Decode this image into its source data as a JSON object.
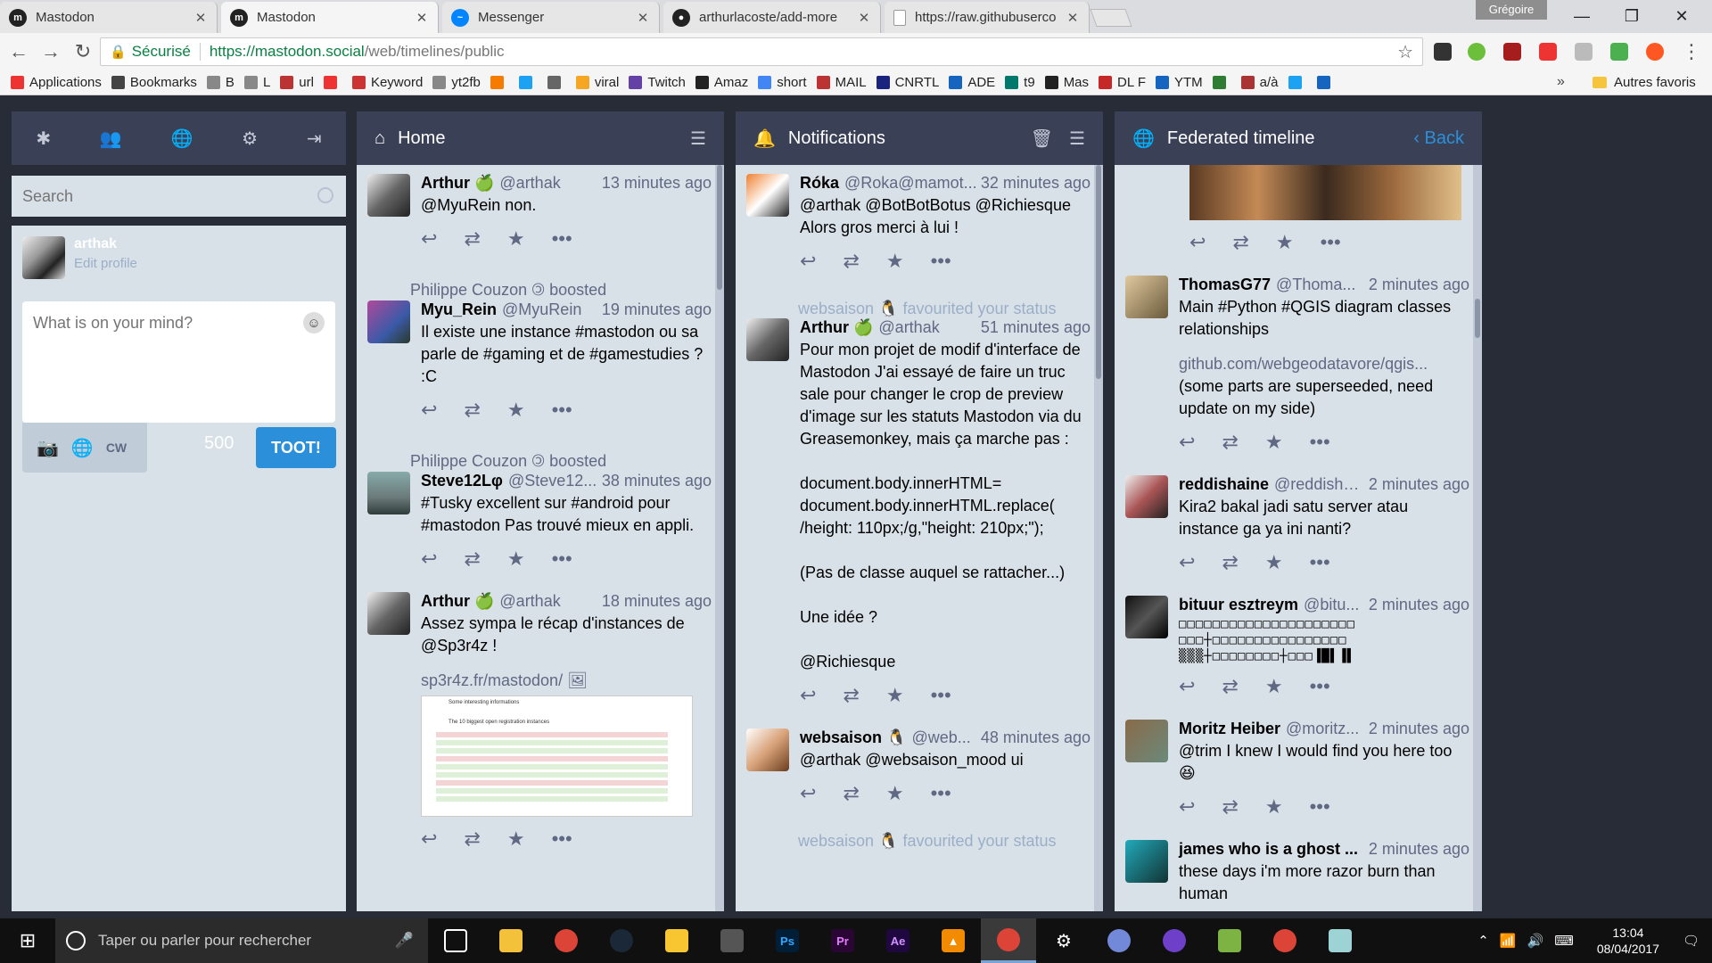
{
  "tabs": [
    {
      "title": "Mastodon",
      "icon": "mastodon-icon",
      "color": "#333"
    },
    {
      "title": "Mastodon",
      "icon": "mastodon-icon",
      "color": "#333"
    },
    {
      "title": "Messenger",
      "icon": "messenger-icon",
      "color": "#0084ff"
    },
    {
      "title": "arthurlacoste/add-more",
      "icon": "github-icon",
      "color": "#222"
    },
    {
      "title": "https://raw.githubuserco",
      "icon": "page-icon",
      "color": "#999"
    }
  ],
  "profile_name": "Grégoire",
  "address": {
    "secure_label": "Sécurisé",
    "host": "https://mastodon.social",
    "path": "/web/timelines/public"
  },
  "bookmarks": [
    "Applications",
    "Bookmarks",
    "B",
    "L",
    "url",
    "",
    "Keyword",
    "yt2fb",
    "",
    "",
    "",
    "viral",
    "Twitch",
    "Amaz",
    "short",
    "MAIL",
    "CNRTL",
    "ADE",
    "t9",
    "Mas",
    "DL F",
    "YTM",
    "",
    "a/à",
    "",
    ""
  ],
  "bookmarks_other": "Autres favoris",
  "compose": {
    "search_placeholder": "Search",
    "account_name": "arthak",
    "edit_profile": "Edit profile",
    "placeholder": "What is on your mind?",
    "cw_label": "CW",
    "char_count": "500",
    "toot_label": "TOOT!"
  },
  "home": {
    "title": "Home",
    "statuses": [
      {
        "name": "Arthur 🍏",
        "acct": "@arthak",
        "time": "13 minutes ago",
        "text": "@MyuRein non."
      },
      {
        "boost": "Philippe Couzon 🄯 boosted",
        "name": "Myu_Rein",
        "acct": "@MyuRein",
        "time": "19 minutes ago",
        "text": "Il existe une instance #mastodon ou sa parle de #gaming et de #gamestudies ? :C"
      },
      {
        "boost": "Philippe Couzon 🄯 boosted",
        "name": "Steve12Lφ",
        "acct": "@Steve12...",
        "time": "38 minutes ago",
        "text": "#Tusky excellent sur #android pour #mastodon Pas trouvé mieux en appli."
      },
      {
        "name": "Arthur 🍏",
        "acct": "@arthak",
        "time": "18 minutes ago",
        "text": "Assez sympa le récap d'instances de @Sp3r4z !",
        "link": "sp3r4z.fr/mastodon/ 🖼",
        "preview_title": "Some interesting informations",
        "preview_sub": "The 10 biggest open registration instances"
      }
    ]
  },
  "notifications": {
    "title": "Notifications",
    "items": [
      {
        "name": "Róka",
        "acct": "@Roka@mamot...",
        "time": "32 minutes ago",
        "text": "@arthak @BotBotBotus @Richiesque Alors gros merci à lui !"
      },
      {
        "notif": "websaison 🐧 favourited your status",
        "name": "Arthur 🍏",
        "acct": "@arthak",
        "time": "51 minutes ago",
        "text": "Pour mon projet de modif d'interface de Mastodon J'ai essayé de faire un truc sale pour changer le crop de preview d'image sur les statuts Mastodon via du Greasemonkey, mais ça marche pas :\n\ndocument.body.innerHTML= document.body.innerHTML.replace( /height: 110px;/g,\"height: 210px;\");\n\n(Pas de classe auquel se rattacher...)\n\nUne idée ?\n\n@Richiesque"
      },
      {
        "name": "websaison 🐧",
        "acct": "@web...",
        "time": "48 minutes ago",
        "text": "@arthak @websaison_mood ui"
      },
      {
        "notif": "websaison 🐧 favourited your status"
      }
    ]
  },
  "federated": {
    "title": "Federated timeline",
    "back_label": "Back",
    "statuses": [
      {
        "name": "ThomasG77",
        "acct": "@Thoma...",
        "time": "2 minutes ago",
        "text": "Main #Python #QGIS diagram classes relationships",
        "link": "github.com/webgeodatavore/qgis...",
        "text2": "(some parts are superseeded, need update on my side)"
      },
      {
        "name": "reddishaine",
        "acct": "@reddisha...",
        "time": "2 minutes ago",
        "text": "Kira2 bakal jadi satu server atau instance ga ya ini nanti?"
      },
      {
        "name": "bituur esztreym",
        "acct": "@bitu...",
        "time": "2 minutes ago",
        "text": "□□□□□□□□□□□□□□□□□□□□□ □□□┼□□□□□□□□□□□□□□□□ ▒▒▒┼□□□□□□□□┼□□□▐█▌▐▌"
      },
      {
        "name": "Moritz Heiber",
        "acct": "@moritz...",
        "time": "2 minutes ago",
        "text": "@trim I knew I would find you here too 😆"
      },
      {
        "name": "james who is a ghost ...",
        "acct": "",
        "time": "2 minutes ago",
        "text": "these days i'm more razor burn than human"
      }
    ]
  },
  "taskbar": {
    "search_placeholder": "Taper ou parler pour rechercher",
    "time": "13:04",
    "date": "08/04/2017"
  },
  "colors": {
    "accent": "#2b90d9",
    "column_bg": "#d9e1e8",
    "header_bg": "#3a4055",
    "app_bg": "#282c37"
  }
}
